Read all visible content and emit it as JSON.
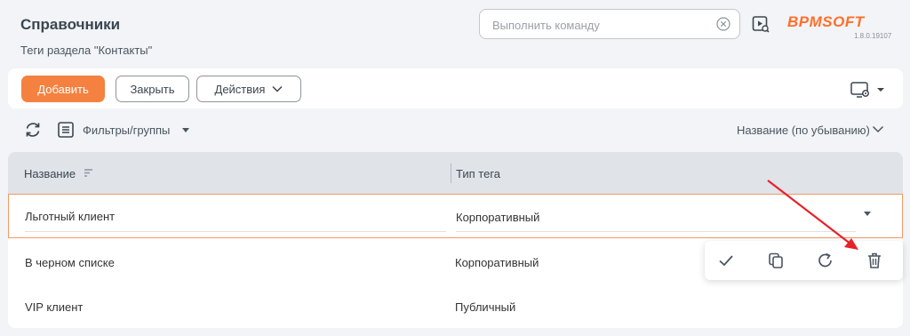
{
  "header": {
    "title": "Справочники",
    "subtitle": "Теги раздела \"Контакты\"",
    "command": {
      "placeholder": "Выполнить команду",
      "value": ""
    },
    "logo": {
      "text": "BPMSOFT",
      "version": "1.8.0.19107"
    }
  },
  "toolbar": {
    "add_label": "Добавить",
    "close_label": "Закрыть",
    "actions_label": "Действия"
  },
  "filterbar": {
    "filters_label": "Фильтры/группы",
    "sort_label": "Название (по убыванию)"
  },
  "grid": {
    "columns": [
      "Название",
      "Тип тега"
    ],
    "rows": [
      {
        "name": "Льготный клиент",
        "type": "Корпоративный"
      },
      {
        "name": "В черном списке",
        "type": "Корпоративный"
      },
      {
        "name": "VIP клиент",
        "type": "Публичный"
      }
    ]
  },
  "row_actions": [
    "check-icon",
    "copy-icon",
    "undo-icon",
    "trash-icon"
  ],
  "colors": {
    "accent": "#f4813f",
    "arrow": "#e8202a",
    "selected_border": "#f29a66"
  }
}
